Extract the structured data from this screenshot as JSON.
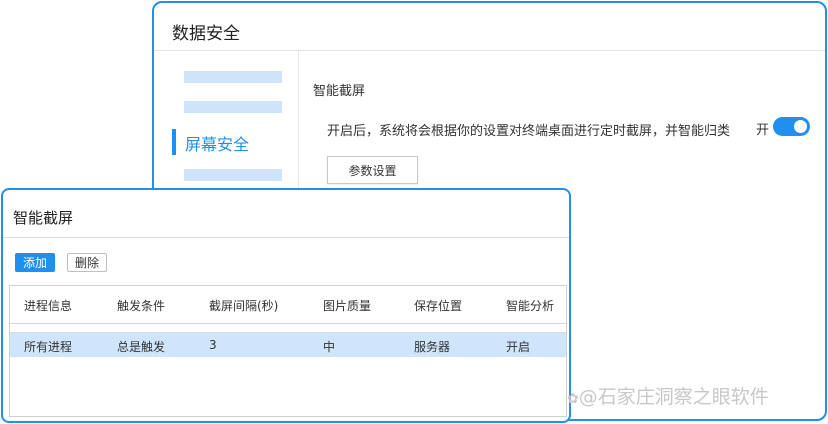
{
  "back_window": {
    "title": "数据安全",
    "nav": {
      "active_label": "屏幕安全"
    },
    "section": {
      "title": "智能截屏",
      "description": "开启后，系统将会根据你的设置对终端桌面进行定时截屏，并智能归类",
      "toggle_label": "开",
      "toggle_on": true,
      "params_button": "参数设置"
    }
  },
  "front_window": {
    "title": "智能截屏",
    "add_button": "添加",
    "delete_button": "删除",
    "table": {
      "headers": [
        "进程信息",
        "触发条件",
        "截屏间隔(秒)",
        "图片质量",
        "保存位置",
        "智能分析"
      ],
      "rows": [
        [
          "所有进程",
          "总是触发",
          "3",
          "中",
          "服务器",
          "开启"
        ]
      ]
    }
  },
  "watermark": "@石家庄洞察之眼软件",
  "colors": {
    "accent": "#1f8ff0",
    "row_highlight": "#cfe5fb",
    "nav_placeholder": "#cfe3fb"
  }
}
